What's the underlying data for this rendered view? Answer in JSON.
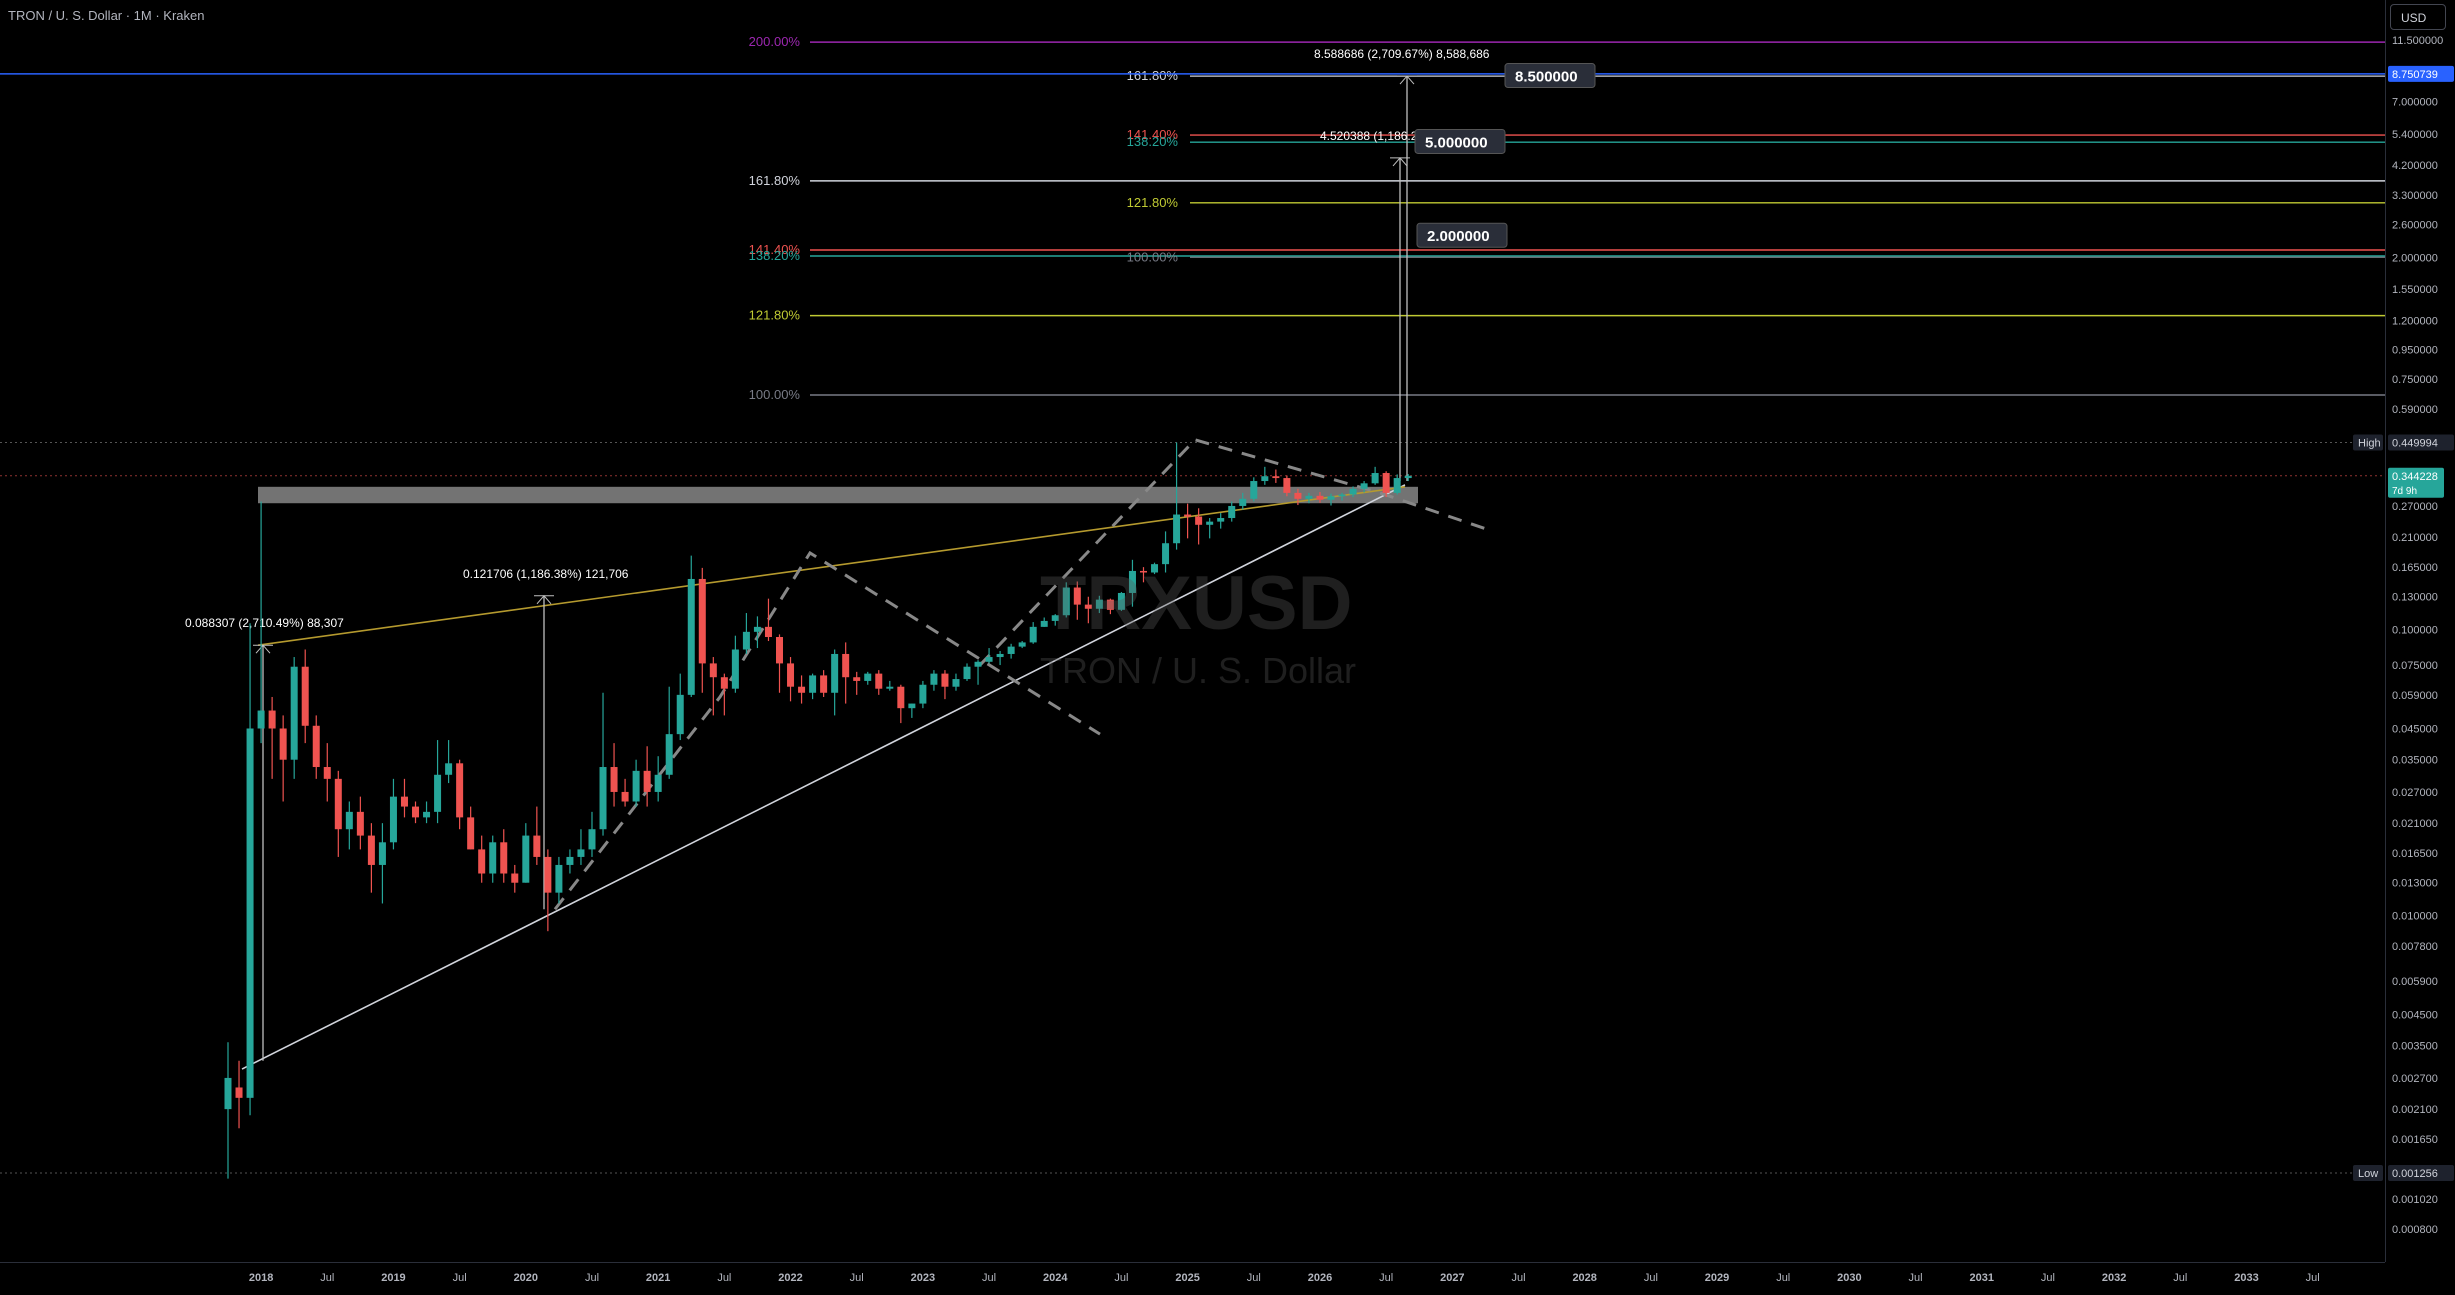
{
  "header": {
    "title": "TRON / U. S. Dollar · 1M · Kraken",
    "currency": "USD"
  },
  "watermark": {
    "symbol": "TRXUSD",
    "name": "TRON / U. S. Dollar"
  },
  "colors": {
    "up": "#26a69a",
    "down": "#ef5350",
    "background": "#000000",
    "purple": "#9c27b0",
    "blue": "#2962ff",
    "yellow_green": "#c0ca33",
    "gold": "#b59a2e",
    "gray": "#787b86"
  },
  "price_axis": {
    "labels": [
      "11.500000",
      "7.000000",
      "5.400000",
      "4.200000",
      "3.300000",
      "2.600000",
      "2.000000",
      "1.550000",
      "1.200000",
      "0.950000",
      "0.750000",
      "0.590000",
      "0.270000",
      "0.210000",
      "0.165000",
      "0.130000",
      "0.100000",
      "0.075000",
      "0.059000",
      "0.045000",
      "0.035000",
      "0.027000",
      "0.021000",
      "0.016500",
      "0.013000",
      "0.010000",
      "0.007800",
      "0.005900",
      "0.004500",
      "0.003500",
      "0.002700",
      "0.002100",
      "0.001650",
      "0.001020",
      "0.000800"
    ],
    "current_price_label": "8.750739",
    "high_label": "High",
    "high_value": "0.449994",
    "last_price": "0.344228",
    "countdown": "7d 9h",
    "low_label": "Low",
    "low_value": "0.001256"
  },
  "time_axis": {
    "labels": [
      "2018",
      "Jul",
      "2019",
      "Jul",
      "2020",
      "Jul",
      "2021",
      "Jul",
      "2022",
      "Jul",
      "2023",
      "Jul",
      "2024",
      "Jul",
      "2025",
      "Jul",
      "2026",
      "Jul",
      "2027",
      "Jul",
      "2028",
      "Jul",
      "2029",
      "Jul",
      "2030",
      "Jul",
      "2031",
      "Jul",
      "2032",
      "Jul",
      "2033",
      "Jul"
    ]
  },
  "fib_left": [
    "200.00%",
    "161.80%",
    "141.40%",
    "138.20%",
    "121.80%",
    "100.00%"
  ],
  "fib_right": [
    "161.80%",
    "141.40%",
    "138.20%",
    "121.80%",
    "100.00%"
  ],
  "measurements": {
    "m1": "0.088307 (2,710.49%) 88,307",
    "m2": "0.121706 (1,186.38%) 121,706",
    "m3": "8.588686 (2,709.67%) 8,588,686",
    "m4": "4.520388 (1,186.2"
  },
  "targets": [
    "8.500000",
    "5.000000",
    "2.000000"
  ],
  "chart_data": {
    "type": "candlestick",
    "symbol": "TRXUSD",
    "interval": "1M",
    "exchange": "Kraken",
    "x_range": [
      "2017-10",
      "2033-12"
    ],
    "y_scale": "log",
    "ylim": [
      0.0007,
      14
    ],
    "high": 0.449994,
    "low": 0.001256,
    "last": 0.344228,
    "price_levels": [
      {
        "label": "8.750739",
        "value": 8.750739
      },
      {
        "label": "8.500000",
        "value": 8.5
      },
      {
        "label": "5.000000",
        "value": 5.0
      },
      {
        "label": "2.000000",
        "value": 2.0
      }
    ],
    "candles": [
      [
        "2017-10",
        0.0021,
        0.0036,
        0.0012,
        0.0027
      ],
      [
        "2017-11",
        0.0025,
        0.0031,
        0.0018,
        0.0023
      ],
      [
        "2017-12",
        0.0023,
        0.105,
        0.002,
        0.045
      ],
      [
        "2018-01",
        0.045,
        0.28,
        0.04,
        0.052
      ],
      [
        "2018-02",
        0.052,
        0.058,
        0.03,
        0.045
      ],
      [
        "2018-03",
        0.045,
        0.05,
        0.025,
        0.035
      ],
      [
        "2018-04",
        0.035,
        0.08,
        0.03,
        0.074
      ],
      [
        "2018-05",
        0.074,
        0.085,
        0.04,
        0.046
      ],
      [
        "2018-06",
        0.046,
        0.05,
        0.03,
        0.033
      ],
      [
        "2018-07",
        0.033,
        0.04,
        0.025,
        0.03
      ],
      [
        "2018-08",
        0.03,
        0.032,
        0.016,
        0.02
      ],
      [
        "2018-09",
        0.02,
        0.025,
        0.017,
        0.023
      ],
      [
        "2018-10",
        0.023,
        0.026,
        0.017,
        0.019
      ],
      [
        "2018-11",
        0.019,
        0.021,
        0.012,
        0.015
      ],
      [
        "2018-12",
        0.015,
        0.021,
        0.011,
        0.018
      ],
      [
        "2019-01",
        0.018,
        0.03,
        0.017,
        0.026
      ],
      [
        "2019-02",
        0.026,
        0.03,
        0.022,
        0.024
      ],
      [
        "2019-03",
        0.024,
        0.025,
        0.021,
        0.022
      ],
      [
        "2019-04",
        0.022,
        0.025,
        0.021,
        0.023
      ],
      [
        "2019-05",
        0.023,
        0.041,
        0.021,
        0.031
      ],
      [
        "2019-06",
        0.031,
        0.041,
        0.029,
        0.034
      ],
      [
        "2019-07",
        0.034,
        0.035,
        0.02,
        0.022
      ],
      [
        "2019-08",
        0.022,
        0.024,
        0.017,
        0.017
      ],
      [
        "2019-09",
        0.017,
        0.019,
        0.013,
        0.014
      ],
      [
        "2019-10",
        0.014,
        0.019,
        0.013,
        0.018
      ],
      [
        "2019-11",
        0.018,
        0.02,
        0.013,
        0.014
      ],
      [
        "2019-12",
        0.014,
        0.015,
        0.012,
        0.013
      ],
      [
        "2020-01",
        0.013,
        0.021,
        0.013,
        0.019
      ],
      [
        "2020-02",
        0.019,
        0.024,
        0.015,
        0.016
      ],
      [
        "2020-03",
        0.016,
        0.017,
        0.0088,
        0.012
      ],
      [
        "2020-04",
        0.012,
        0.016,
        0.011,
        0.015
      ],
      [
        "2020-05",
        0.015,
        0.017,
        0.014,
        0.016
      ],
      [
        "2020-06",
        0.016,
        0.02,
        0.015,
        0.017
      ],
      [
        "2020-07",
        0.017,
        0.023,
        0.016,
        0.02
      ],
      [
        "2020-08",
        0.02,
        0.06,
        0.019,
        0.033
      ],
      [
        "2020-09",
        0.033,
        0.04,
        0.024,
        0.027
      ],
      [
        "2020-10",
        0.027,
        0.03,
        0.024,
        0.025
      ],
      [
        "2020-11",
        0.025,
        0.035,
        0.024,
        0.032
      ],
      [
        "2020-12",
        0.032,
        0.039,
        0.024,
        0.027
      ],
      [
        "2021-01",
        0.027,
        0.036,
        0.025,
        0.031
      ],
      [
        "2021-02",
        0.031,
        0.063,
        0.03,
        0.043
      ],
      [
        "2021-03",
        0.043,
        0.07,
        0.041,
        0.059
      ],
      [
        "2021-04",
        0.059,
        0.181,
        0.058,
        0.15
      ],
      [
        "2021-05",
        0.15,
        0.164,
        0.06,
        0.076
      ],
      [
        "2021-06",
        0.076,
        0.08,
        0.05,
        0.068
      ],
      [
        "2021-07",
        0.068,
        0.07,
        0.05,
        0.062
      ],
      [
        "2021-08",
        0.062,
        0.095,
        0.06,
        0.085
      ],
      [
        "2021-09",
        0.085,
        0.114,
        0.082,
        0.098
      ],
      [
        "2021-10",
        0.098,
        0.111,
        0.086,
        0.102
      ],
      [
        "2021-11",
        0.102,
        0.128,
        0.091,
        0.094
      ],
      [
        "2021-12",
        0.094,
        0.096,
        0.06,
        0.076
      ],
      [
        "2022-01",
        0.076,
        0.08,
        0.056,
        0.063
      ],
      [
        "2022-02",
        0.063,
        0.069,
        0.055,
        0.06
      ],
      [
        "2022-03",
        0.06,
        0.07,
        0.057,
        0.069
      ],
      [
        "2022-04",
        0.069,
        0.072,
        0.058,
        0.06
      ],
      [
        "2022-05",
        0.06,
        0.085,
        0.05,
        0.082
      ],
      [
        "2022-06",
        0.082,
        0.09,
        0.055,
        0.068
      ],
      [
        "2022-07",
        0.068,
        0.071,
        0.059,
        0.066
      ],
      [
        "2022-08",
        0.066,
        0.071,
        0.064,
        0.07
      ],
      [
        "2022-09",
        0.07,
        0.072,
        0.059,
        0.062
      ],
      [
        "2022-10",
        0.062,
        0.066,
        0.061,
        0.063
      ],
      [
        "2022-11",
        0.063,
        0.064,
        0.047,
        0.053
      ],
      [
        "2022-12",
        0.053,
        0.055,
        0.049,
        0.055
      ],
      [
        "2023-01",
        0.055,
        0.066,
        0.053,
        0.064
      ],
      [
        "2023-02",
        0.064,
        0.072,
        0.061,
        0.07
      ],
      [
        "2023-03",
        0.07,
        0.072,
        0.057,
        0.063
      ],
      [
        "2023-04",
        0.063,
        0.07,
        0.061,
        0.067
      ],
      [
        "2023-05",
        0.067,
        0.076,
        0.066,
        0.074
      ],
      [
        "2023-06",
        0.074,
        0.078,
        0.064,
        0.077
      ],
      [
        "2023-07",
        0.077,
        0.086,
        0.076,
        0.08
      ],
      [
        "2023-08",
        0.08,
        0.084,
        0.075,
        0.082
      ],
      [
        "2023-09",
        0.082,
        0.089,
        0.079,
        0.087
      ],
      [
        "2023-10",
        0.087,
        0.091,
        0.086,
        0.09
      ],
      [
        "2023-11",
        0.09,
        0.106,
        0.089,
        0.102
      ],
      [
        "2023-12",
        0.102,
        0.11,
        0.102,
        0.107
      ],
      [
        "2024-01",
        0.107,
        0.113,
        0.103,
        0.112
      ],
      [
        "2024-02",
        0.112,
        0.146,
        0.11,
        0.14
      ],
      [
        "2024-03",
        0.14,
        0.147,
        0.108,
        0.122
      ],
      [
        "2024-04",
        0.122,
        0.13,
        0.105,
        0.118
      ],
      [
        "2024-05",
        0.118,
        0.131,
        0.114,
        0.127
      ],
      [
        "2024-06",
        0.127,
        0.128,
        0.113,
        0.117
      ],
      [
        "2024-07",
        0.117,
        0.135,
        0.116,
        0.134
      ],
      [
        "2024-08",
        0.134,
        0.175,
        0.12,
        0.16
      ],
      [
        "2024-09",
        0.16,
        0.165,
        0.146,
        0.158
      ],
      [
        "2024-10",
        0.158,
        0.171,
        0.156,
        0.169
      ],
      [
        "2024-11",
        0.169,
        0.22,
        0.158,
        0.2
      ],
      [
        "2024-12",
        0.2,
        0.449994,
        0.19,
        0.252
      ],
      [
        "2025-01",
        0.252,
        0.275,
        0.208,
        0.248
      ],
      [
        "2025-02",
        0.248,
        0.265,
        0.198,
        0.232
      ],
      [
        "2025-03",
        0.232,
        0.245,
        0.208,
        0.238
      ],
      [
        "2025-04",
        0.238,
        0.255,
        0.225,
        0.245
      ],
      [
        "2025-05",
        0.245,
        0.28,
        0.238,
        0.27
      ],
      [
        "2025-06",
        0.27,
        0.3,
        0.262,
        0.286
      ],
      [
        "2025-07",
        0.286,
        0.34,
        0.28,
        0.33
      ],
      [
        "2025-08",
        0.33,
        0.37,
        0.32,
        0.343
      ],
      [
        "2025-09",
        0.343,
        0.362,
        0.325,
        0.338
      ],
      [
        "2025-10",
        0.338,
        0.345,
        0.292,
        0.3
      ],
      [
        "2025-11",
        0.3,
        0.31,
        0.272,
        0.286
      ],
      [
        "2025-12",
        0.286,
        0.3,
        0.276,
        0.293
      ],
      [
        "2026-01",
        0.293,
        0.302,
        0.277,
        0.284
      ],
      [
        "2026-02",
        0.284,
        0.298,
        0.271,
        0.292
      ],
      [
        "2026-03",
        0.292,
        0.3,
        0.282,
        0.296
      ],
      [
        "2026-04",
        0.296,
        0.316,
        0.29,
        0.31
      ],
      [
        "2026-05",
        0.31,
        0.33,
        0.301,
        0.324
      ],
      [
        "2026-06",
        0.324,
        0.37,
        0.32,
        0.352
      ],
      [
        "2026-07",
        0.352,
        0.357,
        0.29,
        0.3
      ],
      [
        "2026-08",
        0.3,
        0.348,
        0.296,
        0.338
      ],
      [
        "2026-09",
        0.338,
        0.349,
        0.33,
        0.344228
      ]
    ]
  }
}
